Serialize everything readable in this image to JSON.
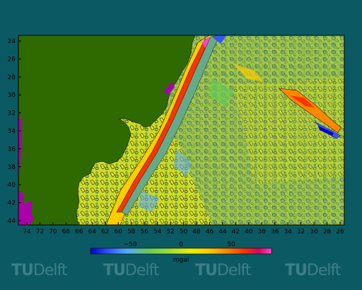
{
  "map": {
    "y_ticks": [
      "24",
      "26",
      "28",
      "30",
      "32",
      "34",
      "36",
      "38",
      "40",
      "42",
      "44"
    ],
    "x_ticks": [
      "74",
      "72",
      "70",
      "68",
      "66",
      "64",
      "62",
      "60",
      "58",
      "56",
      "54",
      "52",
      "50",
      "48",
      "46",
      "44",
      "42",
      "40",
      "38",
      "36",
      "34",
      "32",
      "30",
      "28",
      "26"
    ],
    "land_color": "#2f6a00",
    "background_color": "#0b5a63"
  },
  "colorbar": {
    "ticks": [
      "−50",
      "0",
      "50"
    ],
    "unit": "mgal",
    "colors": [
      "#0000cc",
      "#3355ff",
      "#55aaff",
      "#66cc55",
      "#aadd33",
      "#eeee00",
      "#ffcc00",
      "#ff8800",
      "#ff3300",
      "#dd0066",
      "#ff44cc"
    ]
  },
  "watermarks": [
    {
      "tu": "TU",
      "delft": "Delft"
    },
    {
      "tu": "TU",
      "delft": "Delft"
    },
    {
      "tu": "TU",
      "delft": "Delft"
    },
    {
      "tu": "TU",
      "delft": "Delft"
    }
  ]
}
